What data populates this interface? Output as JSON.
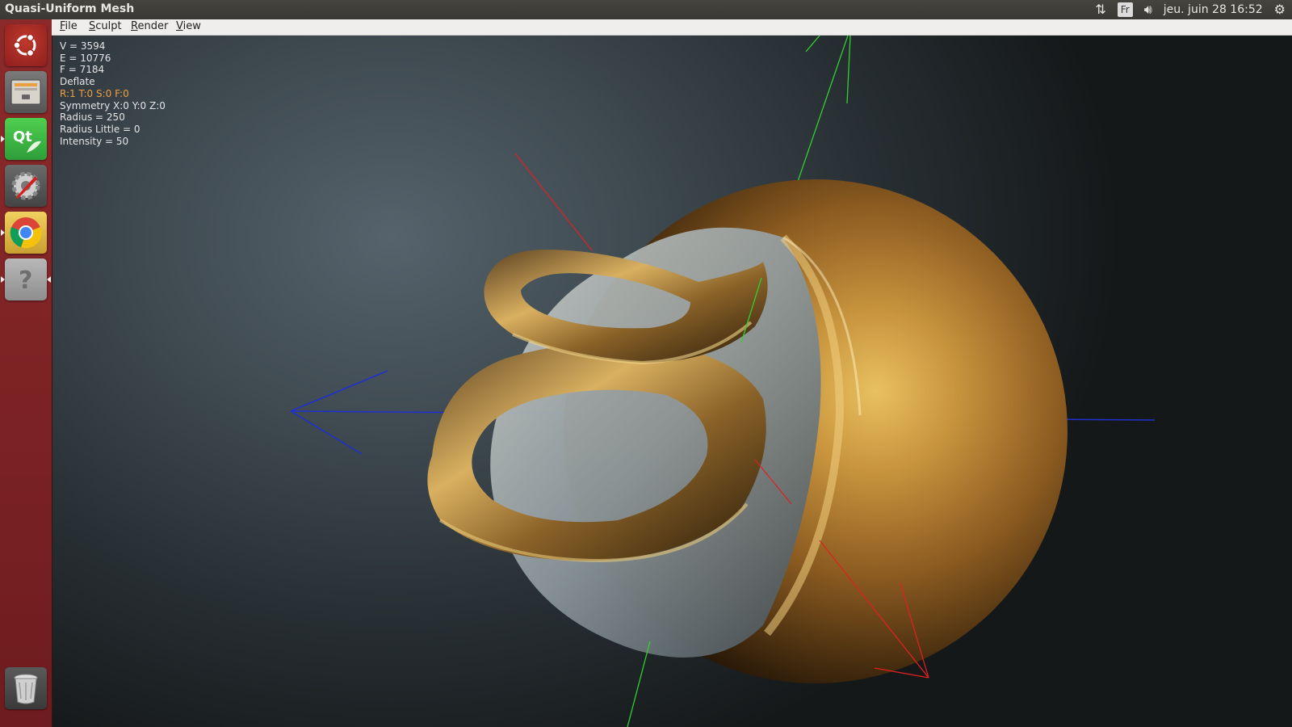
{
  "window": {
    "title": "Quasi-Uniform Mesh"
  },
  "system_tray": {
    "keyboard_layout": "Fr",
    "datetime": "jeu. juin 28 16:52",
    "icons": [
      "network-arrows-icon",
      "volume-icon",
      "gear-icon"
    ]
  },
  "launcher": {
    "items": [
      {
        "name": "ubuntu-dash-icon",
        "running": false
      },
      {
        "name": "files-icon",
        "running": false
      },
      {
        "name": "qt-creator-icon",
        "running": true
      },
      {
        "name": "system-settings-icon",
        "running": false
      },
      {
        "name": "chrome-icon",
        "running": true
      },
      {
        "name": "help-icon",
        "running": true,
        "active": true
      }
    ],
    "trash": "trash-icon"
  },
  "menu": {
    "file": "File",
    "sculpt": "Sculpt",
    "render": "Render",
    "view": "View"
  },
  "hud": {
    "vertices": "V = 3594",
    "edges": "E = 10776",
    "faces": "F = 7184",
    "tool": "Deflate",
    "rtsf": "R:1 T:0 S:0 F:0",
    "symmetry": "Symmetry X:0 Y:0 Z:0",
    "radius": "Radius = 250",
    "radius_little": "Radius Little = 0",
    "intensity": "Intensity = 50"
  },
  "colors": {
    "launcher_bg": "#7e2426",
    "menubar_bg": "#efeeec",
    "hud_text": "#e4e4e4",
    "hud_highlight": "#f0a040",
    "axis_x": "#e02020",
    "axis_y": "#30d030",
    "axis_z": "#2030d0",
    "mesh_gold": "#b8863a"
  }
}
